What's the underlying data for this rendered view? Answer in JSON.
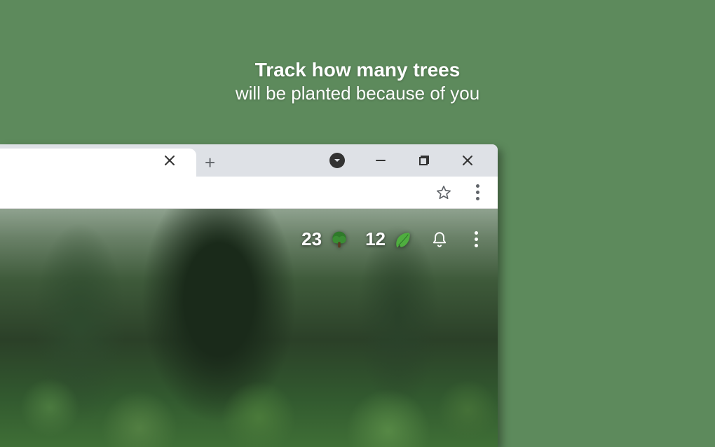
{
  "headline": {
    "line1": "Track how many trees",
    "line2": "will be planted because of you"
  },
  "stats": {
    "trees_count": "23",
    "leaves_count": "12"
  }
}
